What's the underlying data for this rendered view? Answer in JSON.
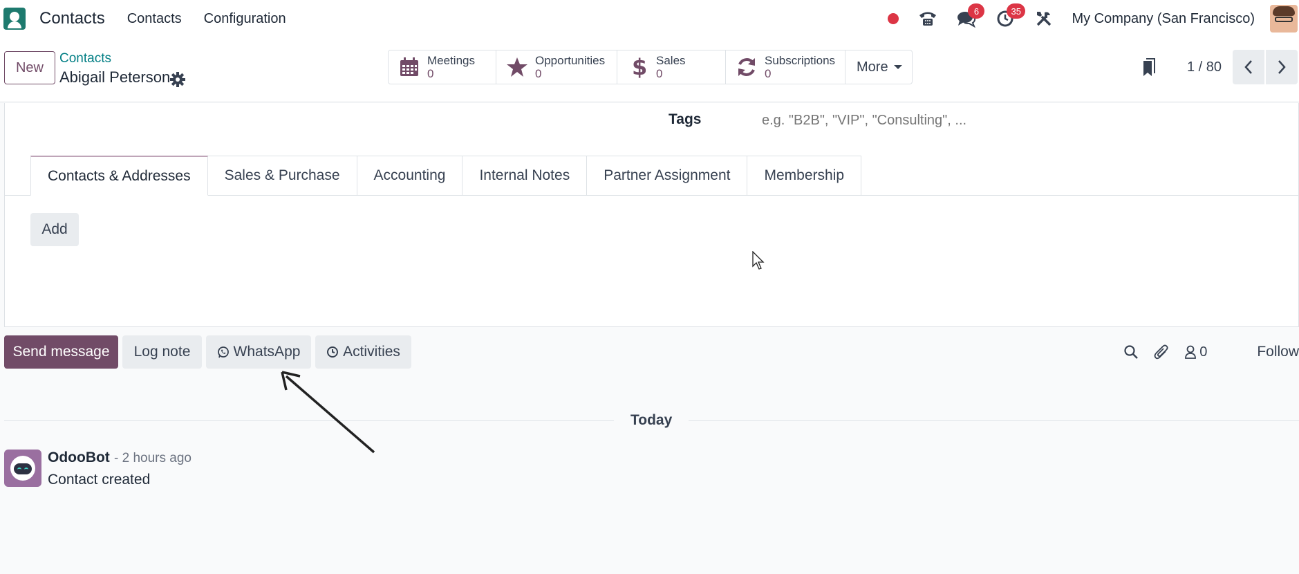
{
  "navbar": {
    "app_name": "Contacts",
    "menu": [
      "Contacts",
      "Configuration"
    ],
    "messages_badge": "6",
    "activities_badge": "35",
    "company": "My Company (San Francisco)"
  },
  "control": {
    "new_label": "New",
    "breadcrumb": "Contacts",
    "record_name": "Abigail Peterson",
    "smart_buttons": [
      {
        "label": "Meetings",
        "value": "0",
        "icon": "calendar-icon"
      },
      {
        "label": "Opportunities",
        "value": "0",
        "icon": "star-icon"
      },
      {
        "label": "Sales",
        "value": "0",
        "icon": "dollar-icon"
      },
      {
        "label": "Subscriptions",
        "value": "0",
        "icon": "refresh-icon"
      }
    ],
    "more_label": "More",
    "pager": "1 / 80"
  },
  "form": {
    "tags_label": "Tags",
    "tags_placeholder": "e.g. \"B2B\", \"VIP\", \"Consulting\", ...",
    "tabs": [
      "Contacts & Addresses",
      "Sales & Purchase",
      "Accounting",
      "Internal Notes",
      "Partner Assignment",
      "Membership"
    ],
    "add_label": "Add"
  },
  "chatter": {
    "send_message": "Send message",
    "log_note": "Log note",
    "whatsapp": "WhatsApp",
    "activities": "Activities",
    "followers_count": "0",
    "follow": "Follow",
    "today": "Today",
    "message": {
      "author": "OdooBot",
      "date": "- 2 hours ago",
      "body": "Contact created"
    }
  },
  "colors": {
    "brand": "#714b67",
    "link": "#017e84",
    "badge": "#dc3545"
  }
}
